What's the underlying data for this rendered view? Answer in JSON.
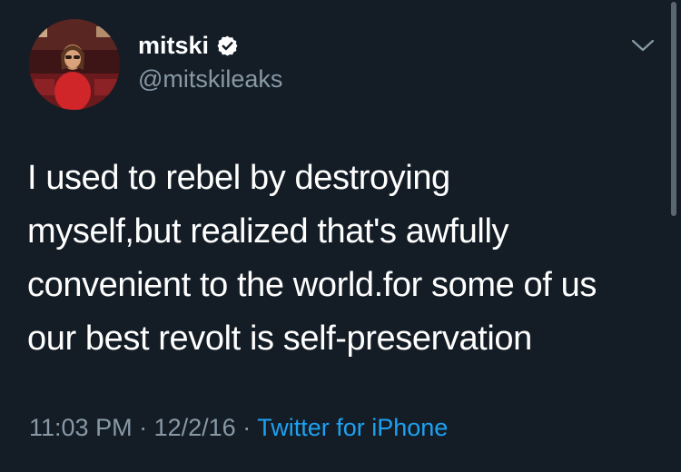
{
  "user": {
    "display_name": "mitski",
    "handle": "@mitskileaks",
    "verified": true,
    "avatar_icon": "profile-photo"
  },
  "tweet": {
    "lines": [
      "I used to rebel by destroying",
      "myself,but realized that's awfully",
      "convenient to the world.for some of us",
      "our best revolt is self-preservation"
    ]
  },
  "meta": {
    "time": "11:03 PM",
    "separator": "·",
    "date": "12/2/16",
    "source": "Twitter for iPhone"
  },
  "colors": {
    "background": "#141d26",
    "text": "#ffffff",
    "secondary_text": "#8899a6",
    "link": "#1da1f2"
  },
  "icons": {
    "verified": "verified-badge-icon",
    "menu": "chevron-down-icon"
  }
}
